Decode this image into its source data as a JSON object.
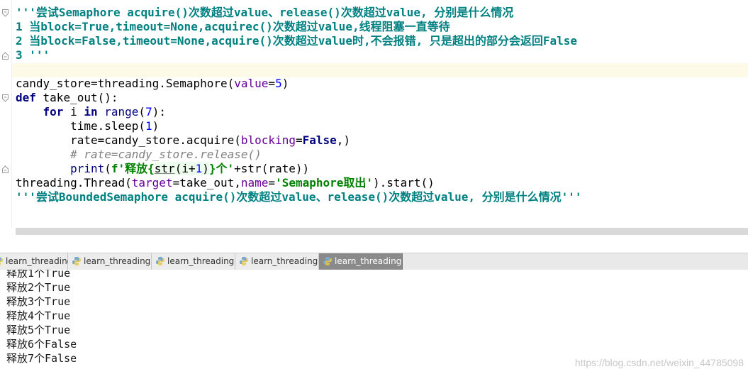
{
  "editor": {
    "line1_doc": "'''尝试Semaphore acquire()次数超过value、release()次数超过value, 分别是什么情况",
    "line2_doc": "1 当block=True,timeout=None,acquirec()次数超过value,线程阻塞一直等待",
    "line3_doc": "2 当block=False,timeout=None,acquire()次数超过value时,不会报错, 只是超出的部分会返回False",
    "line4_doc": "3 '''",
    "line6": {
      "a": "candy_store=threading.Semaphore(",
      "param": "value",
      "eq": "=",
      "num": "5",
      "close": ")"
    },
    "line7": {
      "kw": "def",
      "rest": " take_out():"
    },
    "line8": {
      "indent": "    ",
      "kw_for": "for",
      "i": " i ",
      "kw_in": "in",
      "sp": " ",
      "range": "range",
      "open": "(",
      "num": "7",
      "close": "):"
    },
    "line9": {
      "indent": "        ",
      "a": "time.sleep(",
      "num": "1",
      "close": ")"
    },
    "line10": {
      "indent": "        ",
      "a": "rate=candy_store.acquire(",
      "param": "blocking",
      "eq": "=",
      "kw": "False",
      "close": ",)"
    },
    "line11": {
      "indent": "        ",
      "comment": "# rate=candy_store.release()"
    },
    "line12": {
      "indent": "        ",
      "print": "print",
      "open": "(",
      "fstr1": "f'释放{",
      "inner_a": "str",
      "inner_b": "(i+",
      "inner_num": "1",
      "inner_c": ")",
      "fstr2": "}个'",
      "rest": "+str(rate))"
    },
    "line13": {
      "a": "threading.Thread(",
      "p1": "target",
      "b": "=take_out,",
      "p2": "name",
      "c": "=",
      "str": "'Semaphore取出'",
      "d": ").start()"
    },
    "line14_doc": "'''尝试BoundedSemaphore acquire()次数超过value、release()次数超过value, 分别是什么情况'''"
  },
  "tabs": [
    {
      "label": "learn_threading",
      "active": false
    },
    {
      "label": "learn_threading",
      "active": false
    },
    {
      "label": "learn_threading",
      "active": false
    },
    {
      "label": "learn_threading",
      "active": false
    },
    {
      "label": "learn_threading",
      "active": true
    }
  ],
  "console": {
    "lines": [
      "释放1个True",
      "释放2个True",
      "释放3个True",
      "释放4个True",
      "释放5个True",
      "释放6个False",
      "释放7个False"
    ]
  },
  "watermark": "https://blog.csdn.net/weixin_44785098",
  "colors": {
    "docstring": "#008080",
    "keyword": "#000080",
    "number": "#0000ff",
    "param": "#660099",
    "string": "#008000",
    "comment": "#808080",
    "current_line": "#fdfae7",
    "active_tab": "#8a8a8a"
  }
}
